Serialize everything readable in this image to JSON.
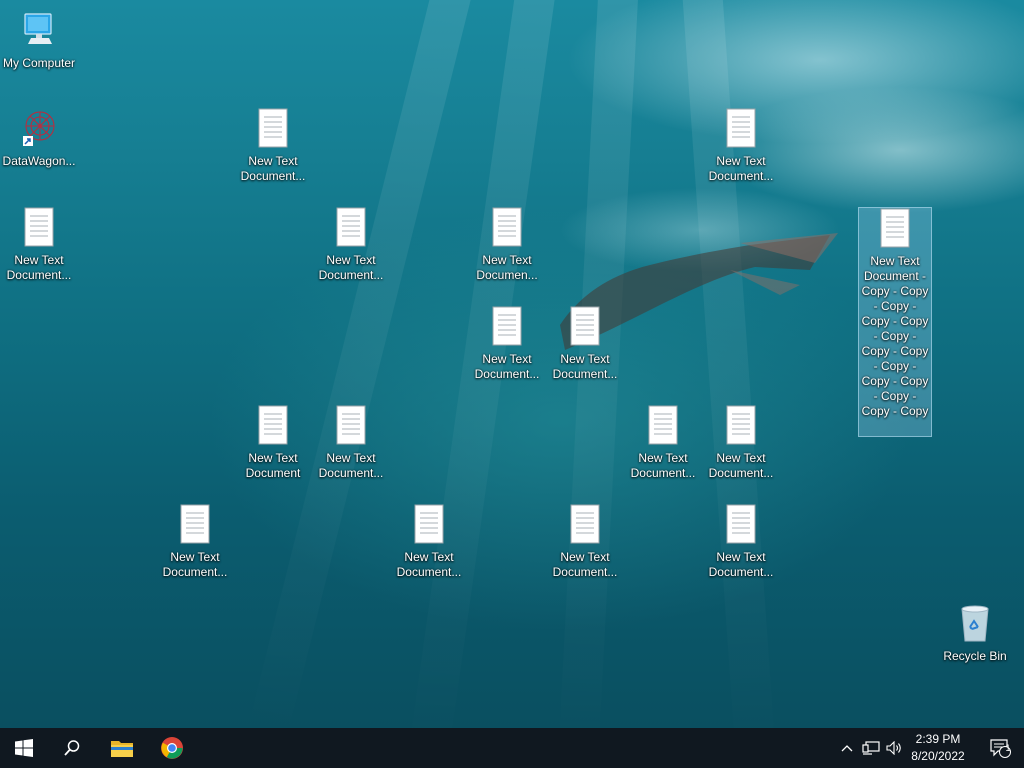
{
  "desktop": {
    "icons": [
      {
        "label": "My Computer"
      },
      {
        "label": "DataWagon..."
      },
      {
        "label": "New Text Document..."
      },
      {
        "label": "New Text Document..."
      },
      {
        "label": "New Text Document..."
      },
      {
        "label": "New Text Document..."
      },
      {
        "label": "New Text Documen..."
      },
      {
        "label": "New Text Document - Copy - Copy - Copy - Copy - Copy - Copy - Copy - Copy - Copy - Copy - Copy - Copy - Copy - Copy"
      },
      {
        "label": "New Text Document..."
      },
      {
        "label": "New Text Document..."
      },
      {
        "label": "New Text Document"
      },
      {
        "label": "New Text Document..."
      },
      {
        "label": "New Text Document..."
      },
      {
        "label": "New Text Document..."
      },
      {
        "label": "New Text Document..."
      },
      {
        "label": "New Text Document..."
      },
      {
        "label": "New Text Document..."
      },
      {
        "label": "New Text Document..."
      },
      {
        "label": "Recycle Bin"
      }
    ]
  },
  "taskbar": {
    "start_icon": "windows-logo-icon",
    "search_icon": "search-icon",
    "pinned": [
      "file-explorer-icon",
      "chrome-icon"
    ],
    "tray_icons": [
      "chevron-up-icon",
      "network-icon",
      "volume-icon"
    ],
    "time": "2:39 PM",
    "date": "8/20/2022",
    "notification_count": "1"
  }
}
